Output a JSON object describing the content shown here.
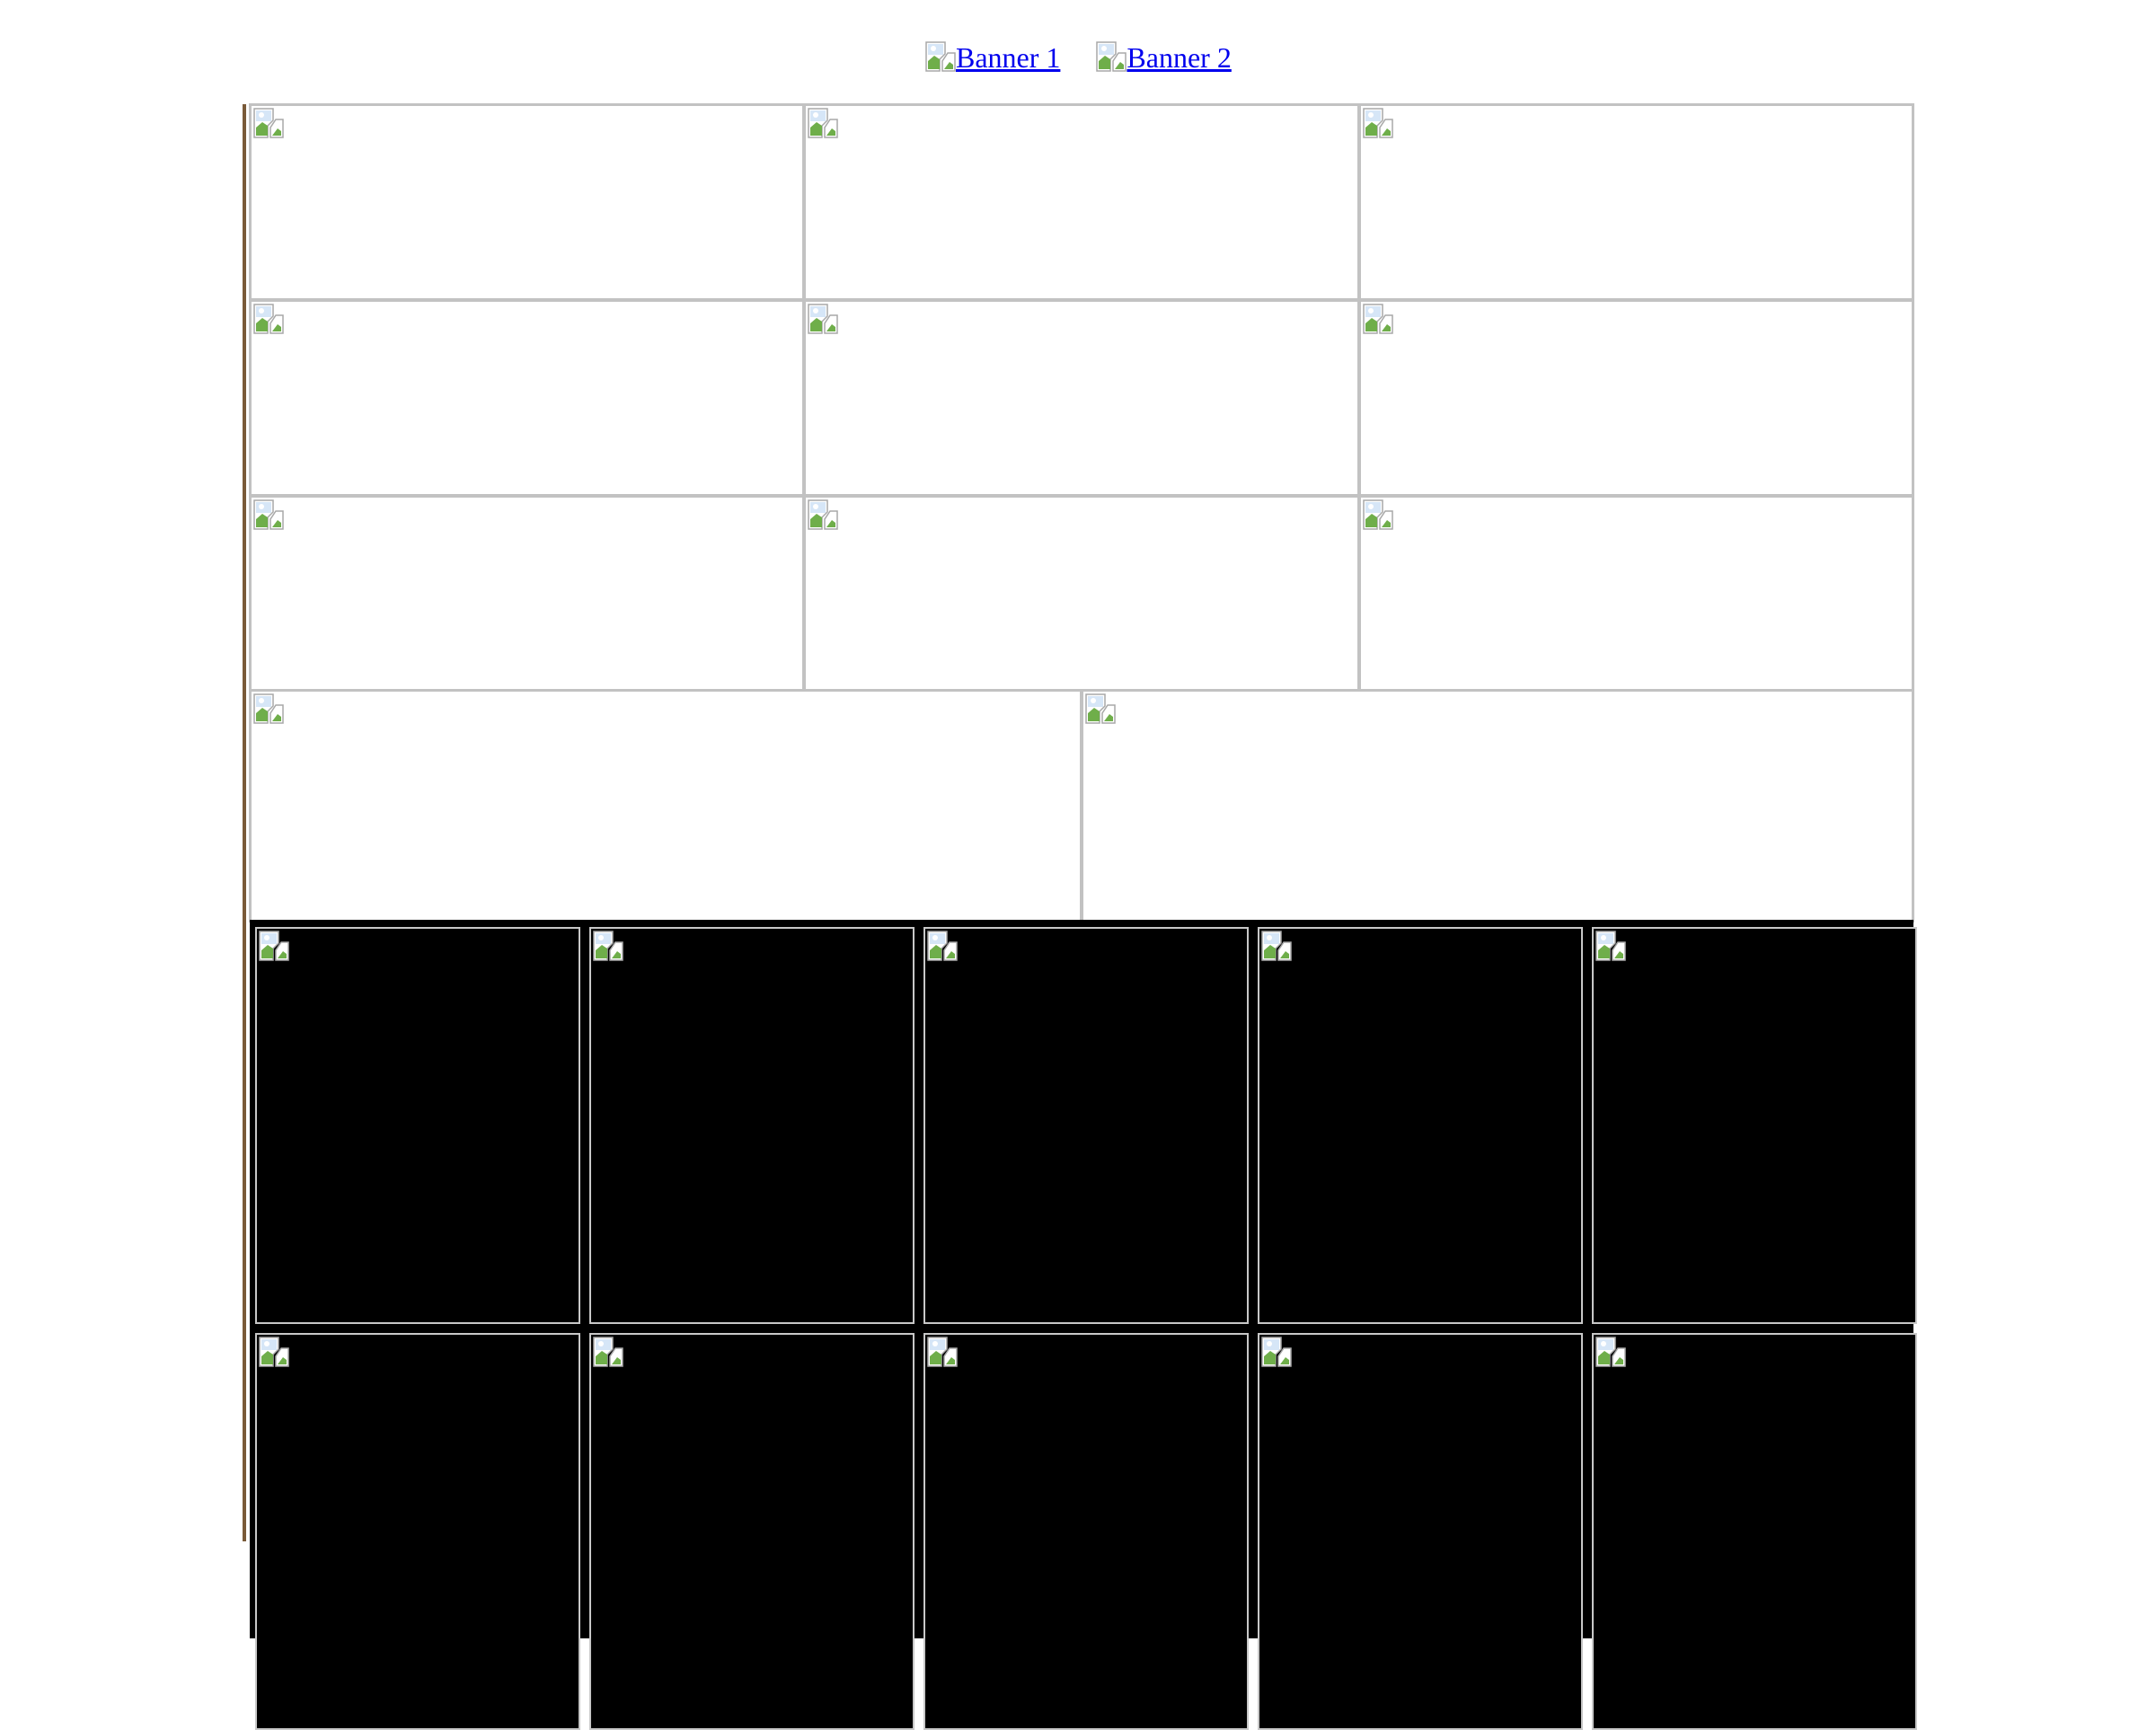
{
  "banners": [
    {
      "label": "Banner 1"
    },
    {
      "label": "Banner 2"
    }
  ],
  "image_grid": {
    "rows_of_three": 3,
    "row_of_two": 2
  },
  "thumbnails": {
    "count_visible": 10
  },
  "colors": {
    "link": "#0000ee",
    "frame_border": "#7a5a38",
    "cell_border": "#c2c2c2",
    "thumb_background": "#000000"
  }
}
